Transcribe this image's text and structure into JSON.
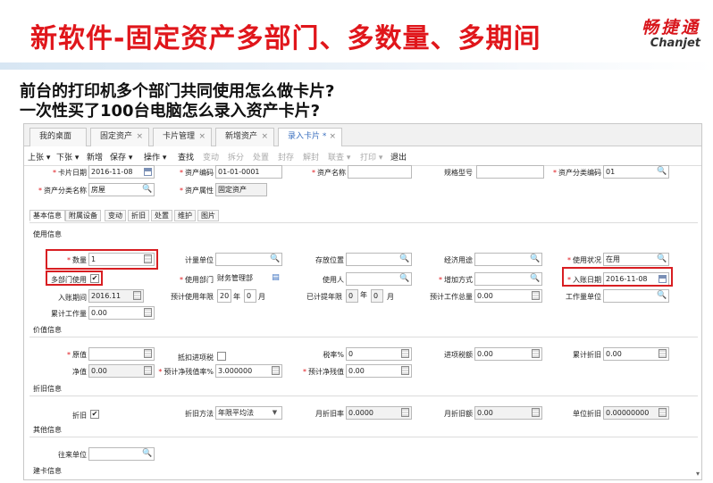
{
  "slide": {
    "title": "新软件-固定资产多部门、多数量、多期间",
    "brand_cn": "畅捷通",
    "brand_en": "Chanjet",
    "question1": "前台的打印机多个部门共同使用怎么做卡片?",
    "question2": "一次性买了100台电脑怎么录入资产卡片?"
  },
  "colors": {
    "title_red": "#e0161b",
    "highlight_red": "#d81e22",
    "active_tab_blue": "#3a6fbf"
  },
  "tabs": [
    {
      "label": "我的桌面"
    },
    {
      "label": "固定资产"
    },
    {
      "label": "卡片管理"
    },
    {
      "label": "新增资产"
    },
    {
      "label": "录入卡片 *"
    }
  ],
  "toolbar": [
    {
      "label": "上张 ▾",
      "enabled": true
    },
    {
      "label": "下张 ▾",
      "enabled": true
    },
    {
      "label": "新增",
      "enabled": true
    },
    {
      "label": "保存 ▾",
      "enabled": true
    },
    {
      "label": "操作 ▾",
      "enabled": true
    },
    {
      "label": "查找",
      "enabled": true
    },
    {
      "label": "变动",
      "enabled": false
    },
    {
      "label": "拆分",
      "enabled": false
    },
    {
      "label": "处置",
      "enabled": false
    },
    {
      "label": "封存",
      "enabled": false
    },
    {
      "label": "解封",
      "enabled": false
    },
    {
      "label": "联查 ▾",
      "enabled": false
    },
    {
      "label": "打印 ▾",
      "enabled": false
    },
    {
      "label": "退出",
      "enabled": true
    }
  ],
  "header": {
    "card_date_label": "卡片日期",
    "card_date": "2016-11-08",
    "asset_code_label": "资产编码",
    "asset_code": "01-01-0001",
    "asset_name_label": "资产名称",
    "asset_name": "",
    "spec_label": "规格型号",
    "spec": "",
    "category_code_label": "资产分类编码",
    "category_code": "01",
    "category_name_label": "资产分类名称",
    "category_name": "房屋",
    "asset_attr_label": "资产属性",
    "asset_attr": "固定资产"
  },
  "subtabs": [
    "基本信息",
    "附属设备",
    "变动",
    "折旧",
    "处置",
    "维护",
    "图片"
  ],
  "sections": {
    "usage": "使用信息",
    "value": "价值信息",
    "depreciation": "折旧信息",
    "other": "其他信息",
    "build": "建卡信息"
  },
  "usage": {
    "qty_label": "数量",
    "qty": "1",
    "unit_label": "计量单位",
    "unit": "",
    "location_label": "存放位置",
    "location": "",
    "purpose_label": "经济用途",
    "purpose": "",
    "status_label": "使用状况",
    "status": "在用",
    "multi_dept_label": "多部门使用",
    "multi_dept_checked": "✔",
    "dept_label": "使用部门",
    "dept": "财务管理部",
    "user_label": "使用人",
    "user": "",
    "add_method_label": "增加方式",
    "add_method": "",
    "entry_date_label": "入账日期",
    "entry_date": "2016-11-08",
    "entry_period_label": "入账期间",
    "entry_period": "2016.11",
    "est_life_label": "预计使用年限",
    "est_life_year": "20",
    "year_unit": "年",
    "est_life_month": "0",
    "month_unit": "月",
    "used_life_label": "已计提年限",
    "used_life_year": "0",
    "used_life_month": "0",
    "est_workload_label": "预计工作总量",
    "est_workload": "0.00",
    "workload_unit_label": "工作量单位",
    "workload_unit": "",
    "acc_workload_label": "累计工作量",
    "acc_workload": "0.00"
  },
  "value": {
    "orig_label": "原值",
    "orig": "",
    "deduct_label": "抵扣进项税",
    "deduct_checked": "",
    "tax_rate_label": "税率%",
    "tax_rate": "0",
    "input_tax_label": "进项税额",
    "input_tax": "0.00",
    "acc_dep_label": "累计折旧",
    "acc_dep": "0.00",
    "net_label": "净值",
    "net": "0.00",
    "salvage_rate_label": "预计净残值率%",
    "salvage_rate": "3.000000",
    "salvage_label": "预计净残值",
    "salvage": "0.00"
  },
  "depreciation": {
    "dep_label": "折旧",
    "dep_checked": "✔",
    "method_label": "折旧方法",
    "method": "年限平均法",
    "monthly_rate_label": "月折旧率",
    "monthly_rate": "0.0000",
    "monthly_amt_label": "月折旧额",
    "monthly_amt": "0.00",
    "unit_dep_label": "单位折旧",
    "unit_dep": "0.00000000"
  },
  "other": {
    "partner_label": "往来单位",
    "partner": ""
  }
}
